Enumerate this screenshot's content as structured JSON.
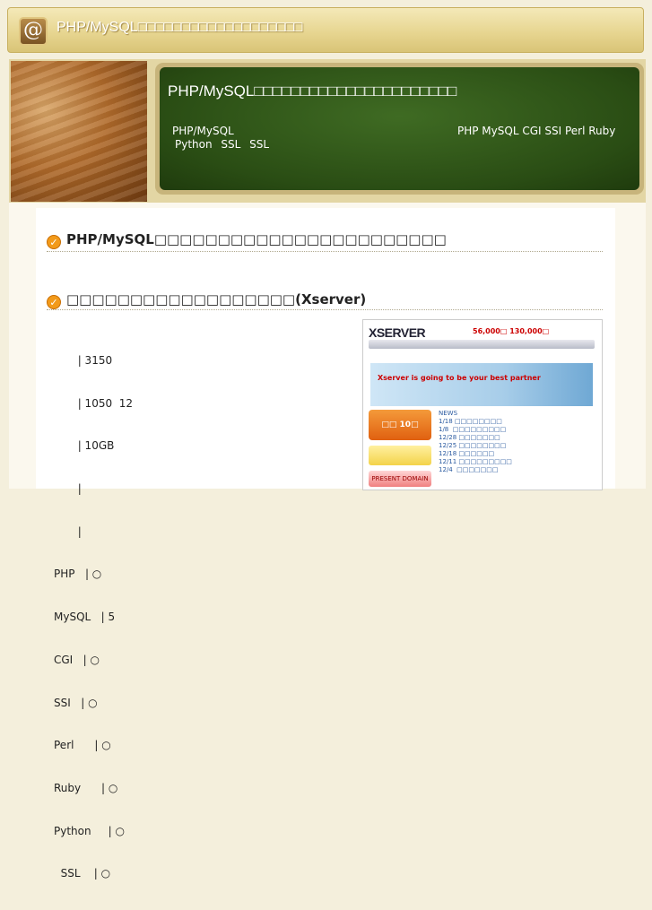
{
  "site": {
    "title": "PHP/MySQL□□□□□□□□□□□□□□□□□□□",
    "icon": "at-sign-icon",
    "icon_glyph": "@"
  },
  "header": {
    "board_title": "PHP/MySQL□□□□□□□□□□□□□□□□□□□□□□",
    "desc_left": "PHP/MySQL",
    "desc_right": "PHP MySQL CGI SSI Perl Ruby",
    "desc_line2": "Python SSL SSL"
  },
  "sections": [
    {
      "heading": "PHP/MySQL□□□□□□□□□□□□□□□□□□□□□□□"
    },
    {
      "heading": "□□□□□□□□□□□□□□□□□□(Xserver)"
    }
  ],
  "specs": [
    "       | 3150",
    "       | 1050  12",
    "       | 10GB",
    "       |",
    "       |",
    "PHP   | ○",
    "MySQL   | 5",
    "CGI   | ○",
    "SSI   | ○",
    "Perl      | ○",
    "Ruby      | ○",
    "Python     | ○",
    "  SSL    | ○"
  ],
  "thumbnail": {
    "logo": "XSERVER",
    "promo": "56,000□ 130,000□",
    "banner_text": "Xserver is going to be your best partner",
    "badge_text": "□□ 10□",
    "badge3_text": "PRESENT DOMAIN",
    "news": "NEWS\n1/18 □□□□□□□□\n1/8  □□□□□□□□□\n12/28 □□□□□□□\n12/25 □□□□□□□□\n12/18 □□□□□□\n12/11 □□□□□□□□□\n12/4  □□□□□□□"
  }
}
